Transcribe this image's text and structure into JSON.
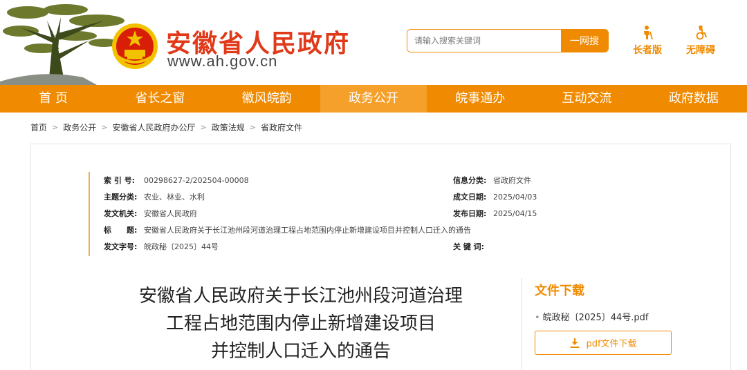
{
  "header": {
    "site_title": "安徽省人民政府",
    "site_url": "www.ah.gov.cn",
    "search_placeholder": "请输入搜索关键词",
    "search_button": "一网搜",
    "elder_mode": "长者版",
    "accessibility_mode": "无障碍"
  },
  "nav": {
    "items": [
      "首 页",
      "省长之窗",
      "徽风皖韵",
      "政务公开",
      "皖事通办",
      "互动交流",
      "政府数据"
    ],
    "active_index": 3
  },
  "breadcrumb": [
    "首页",
    "政务公开",
    "安徽省人民政府办公厅",
    "政策法规",
    "省政府文件"
  ],
  "meta": {
    "index_label": "索 引 号:",
    "index_value": "00298627-2/202504-00008",
    "category_label": "信息分类:",
    "category_value": "省政府文件",
    "topic_label": "主题分类:",
    "topic_value": "农业、林业、水利",
    "created_label": "成文日期:",
    "created_value": "2025/04/03",
    "issuer_label": "发文机关:",
    "issuer_value": "安徽省人民政府",
    "published_label": "发布日期:",
    "published_value": "2025/04/15",
    "title_label": "标　　题:",
    "title_value": "安徽省人民政府关于长江池州段河道治理工程占地范围内停止新增建设项目并控制人口迁入的通告",
    "docno_label": "发文字号:",
    "docno_value": "皖政秘〔2025〕44号",
    "keywords_label": "关 键 词:",
    "keywords_value": ""
  },
  "document": {
    "title_line1": "安徽省人民政府关于长江池州段河道治理",
    "title_line2": "工程占地范围内停止新增建设项目",
    "title_line3": "并控制人口迁入的通告"
  },
  "download": {
    "heading": "文件下载",
    "file_name": "皖政秘〔2025〕44号.pdf",
    "button_label": "pdf文件下载"
  },
  "colors": {
    "brand_orange": "#f08a00",
    "title_red": "#e03a1a"
  }
}
